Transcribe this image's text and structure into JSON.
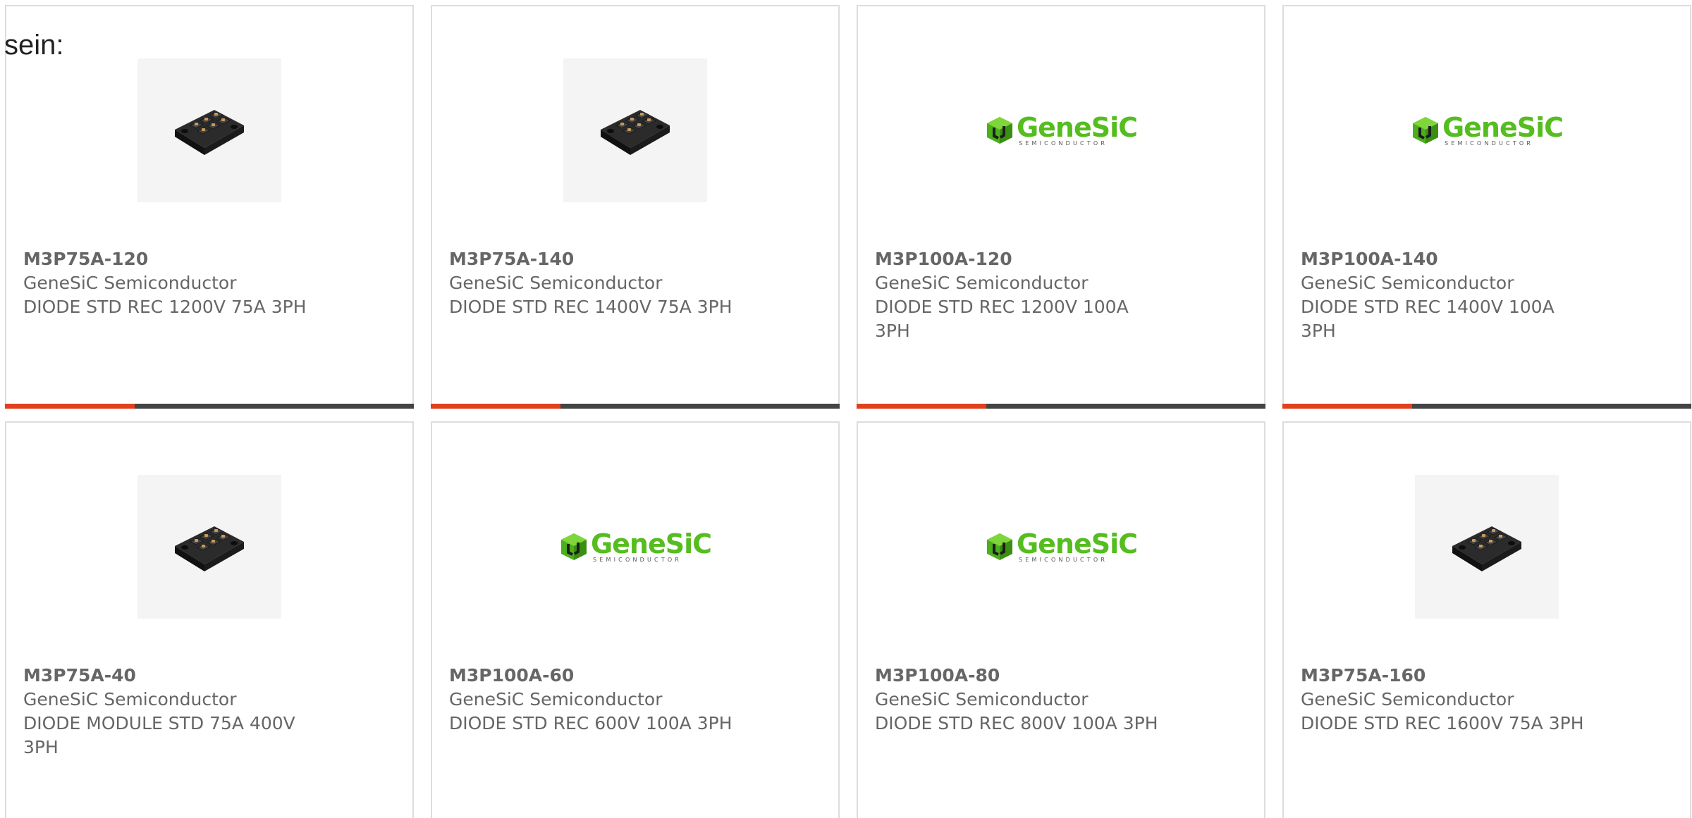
{
  "intro_text": "sein:",
  "colors": {
    "accent": "#e0411c",
    "bar_dark": "#444444",
    "logo_green": "#55bd1f",
    "text": "#666666"
  },
  "logo": {
    "name": "GeneSiC",
    "subtitle": "SEMICONDUCTOR"
  },
  "products": [
    {
      "part": "M3P75A-120",
      "maker": "GeneSiC Semiconductor",
      "desc": "DIODE STD REC 1200V 75A 3PH",
      "image": "module"
    },
    {
      "part": "M3P75A-140",
      "maker": "GeneSiC Semiconductor",
      "desc": "DIODE STD REC 1400V 75A 3PH",
      "image": "module"
    },
    {
      "part": "M3P100A-120",
      "maker": "GeneSiC Semiconductor",
      "desc": "DIODE STD REC 1200V 100A 3PH",
      "image": "logo"
    },
    {
      "part": "M3P100A-140",
      "maker": "GeneSiC Semiconductor",
      "desc": "DIODE STD REC 1400V 100A 3PH",
      "image": "logo"
    },
    {
      "part": "M3P75A-40",
      "maker": "GeneSiC Semiconductor",
      "desc": "DIODE MODULE STD 75A 400V 3PH",
      "image": "module"
    },
    {
      "part": "M3P100A-60",
      "maker": "GeneSiC Semiconductor",
      "desc": "DIODE STD REC 600V 100A 3PH",
      "image": "logo"
    },
    {
      "part": "M3P100A-80",
      "maker": "GeneSiC Semiconductor",
      "desc": "DIODE STD REC 800V 100A 3PH",
      "image": "logo"
    },
    {
      "part": "M3P75A-160",
      "maker": "GeneSiC Semiconductor",
      "desc": "DIODE STD REC 1600V 75A 3PH",
      "image": "module"
    }
  ]
}
